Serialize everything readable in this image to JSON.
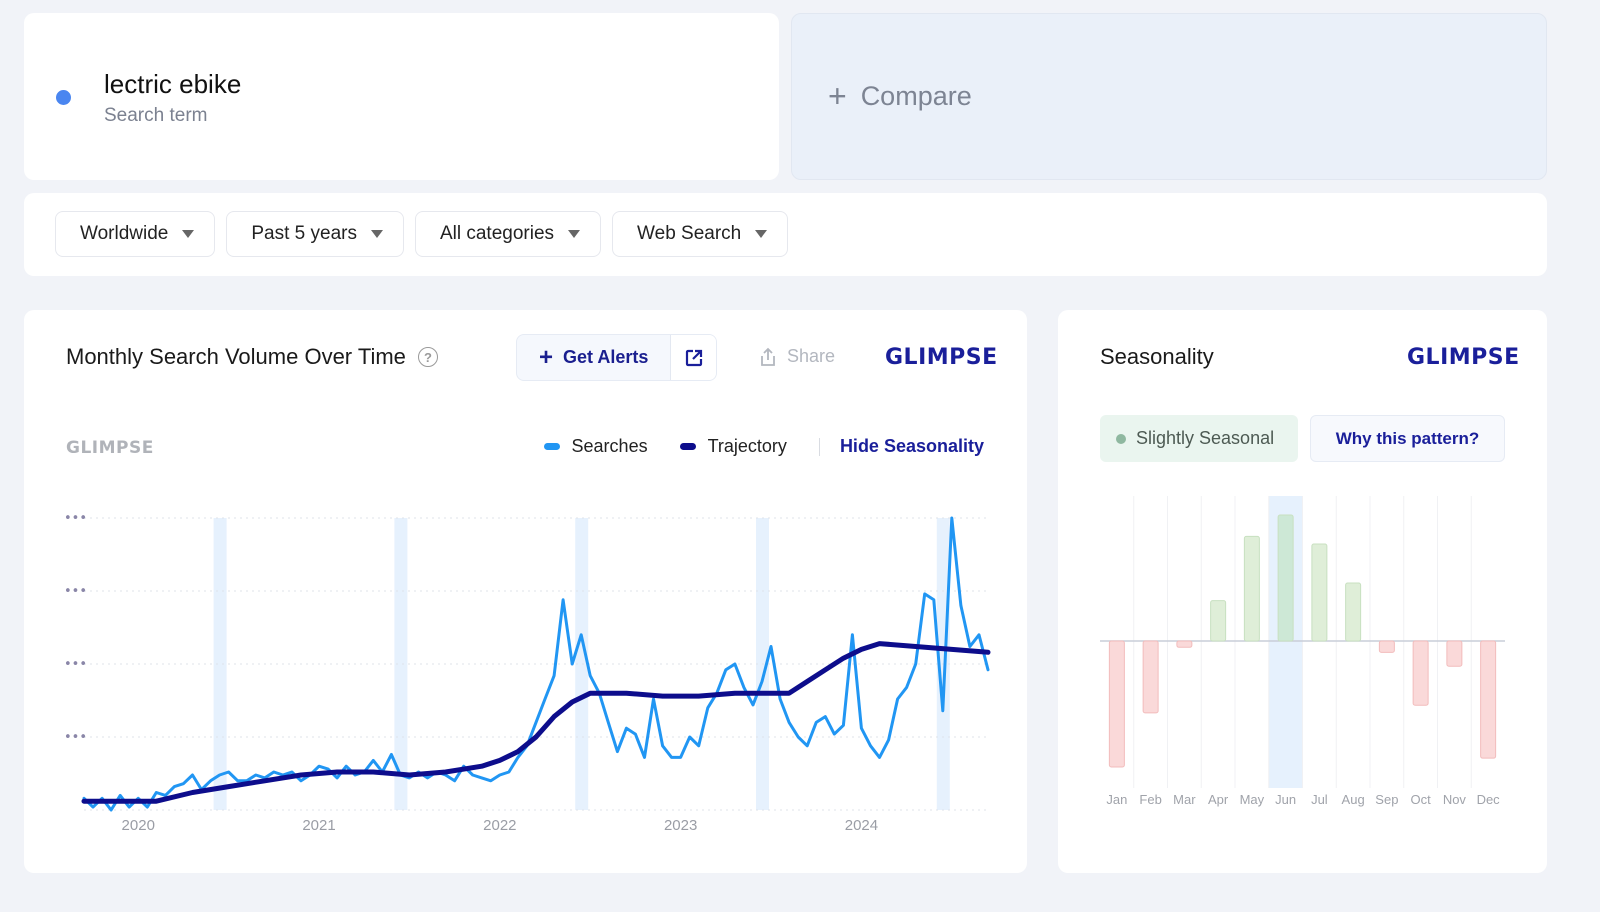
{
  "term": {
    "name": "lectric ebike",
    "subtitle": "Search term",
    "color": "#4a86f0"
  },
  "compare": {
    "icon": "plus-icon",
    "label": "Compare"
  },
  "filters": [
    {
      "label": "Worldwide",
      "icon": "caret-down-icon"
    },
    {
      "label": "Past 5 years",
      "icon": "caret-down-icon"
    },
    {
      "label": "All categories",
      "icon": "caret-down-icon"
    },
    {
      "label": "Web Search",
      "icon": "caret-down-icon"
    }
  ],
  "volume_card": {
    "title": "Monthly Search Volume Over Time",
    "help_icon": "?",
    "get_alerts_label": "Get Alerts",
    "external_link_icon": "external-link-icon",
    "share_label": "Share",
    "brand": "GLIMPSE",
    "watermark": "GLIMPSE",
    "legend": {
      "searches": "Searches",
      "trajectory": "Trajectory",
      "hide_seasonality": "Hide Seasonality"
    },
    "y_tick_label": "•••"
  },
  "season_card": {
    "title": "Seasonality",
    "brand": "GLIMPSE",
    "badge_label": "Slightly Seasonal",
    "badge_dot_color": "#8fb8a0",
    "why_label": "Why this pattern?"
  },
  "colors": {
    "searches": "#2196f3",
    "trajectory": "#0d0d8c",
    "brand": "#1a1f9a",
    "highlight_band": "#e6f1fd",
    "positive_bar": "#dfeed8",
    "positive_bar_highlight": "#cde8d6",
    "negative_bar": "#fad9d9"
  },
  "chart_data": [
    {
      "type": "line",
      "title": "Monthly Search Volume Over Time",
      "xlabel": "",
      "ylabel": "",
      "x_tick_labels": [
        "2020",
        "2021",
        "2022",
        "2023",
        "2024"
      ],
      "y_tick_labels": [
        "•••",
        "•••",
        "•••",
        "•••"
      ],
      "ylim": [
        0,
        100
      ],
      "xlim": [
        2019.7,
        2024.7
      ],
      "grid": true,
      "legend_position": "top-right",
      "highlight_bands_x": [
        2020.45,
        2021.45,
        2022.45,
        2023.45,
        2024.45
      ],
      "series": [
        {
          "name": "Searches",
          "x": [
            2019.7,
            2019.75,
            2019.8,
            2019.85,
            2019.9,
            2019.95,
            2020.0,
            2020.05,
            2020.1,
            2020.15,
            2020.2,
            2020.25,
            2020.3,
            2020.35,
            2020.4,
            2020.45,
            2020.5,
            2020.55,
            2020.6,
            2020.65,
            2020.7,
            2020.75,
            2020.8,
            2020.85,
            2020.9,
            2020.95,
            2021.0,
            2021.05,
            2021.1,
            2021.15,
            2021.2,
            2021.25,
            2021.3,
            2021.35,
            2021.4,
            2021.45,
            2021.5,
            2021.55,
            2021.6,
            2021.65,
            2021.7,
            2021.75,
            2021.8,
            2021.85,
            2021.9,
            2021.95,
            2022.0,
            2022.05,
            2022.1,
            2022.15,
            2022.2,
            2022.25,
            2022.3,
            2022.35,
            2022.4,
            2022.45,
            2022.5,
            2022.55,
            2022.6,
            2022.65,
            2022.7,
            2022.75,
            2022.8,
            2022.85,
            2022.9,
            2022.95,
            2023.0,
            2023.05,
            2023.1,
            2023.15,
            2023.2,
            2023.25,
            2023.3,
            2023.35,
            2023.4,
            2023.45,
            2023.5,
            2023.55,
            2023.6,
            2023.65,
            2023.7,
            2023.75,
            2023.8,
            2023.85,
            2023.9,
            2023.95,
            2024.0,
            2024.05,
            2024.1,
            2024.15,
            2024.2,
            2024.25,
            2024.3,
            2024.35,
            2024.4,
            2024.45,
            2024.5,
            2024.55,
            2024.6,
            2024.65,
            2024.7
          ],
          "values": [
            4,
            1,
            4,
            0,
            5,
            1,
            4,
            1,
            6,
            5,
            8,
            9,
            12,
            7,
            10,
            12,
            13,
            10,
            10,
            12,
            11,
            13,
            12,
            13,
            10,
            12,
            15,
            14,
            11,
            15,
            12,
            13,
            17,
            13,
            19,
            12,
            11,
            13,
            11,
            13,
            12,
            10,
            15,
            12,
            11,
            10,
            12,
            13,
            18,
            22,
            30,
            38,
            46,
            72,
            50,
            60,
            46,
            40,
            30,
            20,
            28,
            26,
            18,
            38,
            22,
            18,
            18,
            25,
            22,
            35,
            40,
            48,
            50,
            42,
            36,
            44,
            56,
            38,
            30,
            25,
            22,
            30,
            32,
            26,
            29,
            60,
            28,
            22,
            18,
            24,
            38,
            42,
            50,
            74,
            72,
            34,
            100,
            70,
            56,
            60,
            48,
            50
          ]
        },
        {
          "name": "Trajectory",
          "x": [
            2019.7,
            2019.9,
            2020.1,
            2020.3,
            2020.5,
            2020.7,
            2020.9,
            2021.1,
            2021.3,
            2021.5,
            2021.7,
            2021.9,
            2022.0,
            2022.1,
            2022.2,
            2022.3,
            2022.4,
            2022.5,
            2022.7,
            2022.9,
            2023.1,
            2023.3,
            2023.5,
            2023.6,
            2023.7,
            2023.8,
            2023.9,
            2024.0,
            2024.1,
            2024.3,
            2024.5,
            2024.7
          ],
          "values": [
            3,
            3,
            3,
            6,
            8,
            10,
            12,
            13,
            13,
            12,
            13,
            15,
            17,
            20,
            25,
            32,
            37,
            40,
            40,
            39,
            39,
            40,
            40,
            40,
            44,
            48,
            52,
            55,
            57,
            56,
            55,
            54
          ]
        }
      ]
    },
    {
      "type": "bar",
      "title": "Seasonality",
      "categories": [
        "Jan",
        "Feb",
        "Mar",
        "Apr",
        "May",
        "Jun",
        "Jul",
        "Aug",
        "Sep",
        "Oct",
        "Nov",
        "Dec"
      ],
      "values": [
        -100,
        -57,
        -5,
        32,
        83,
        100,
        77,
        46,
        -9,
        -51,
        -20,
        -93
      ],
      "highlighted_category": "Jun",
      "ylim": [
        -100,
        100
      ],
      "xlabel": "",
      "ylabel": ""
    }
  ]
}
